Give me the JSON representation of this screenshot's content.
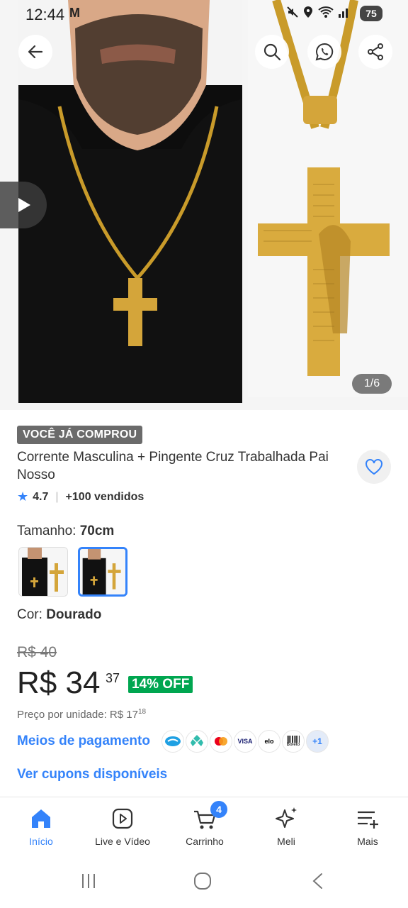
{
  "status_bar": {
    "time": "12:44",
    "mail_icon": "M",
    "battery": "75"
  },
  "gallery": {
    "counter": "1/6"
  },
  "product": {
    "badge": "VOCÊ JÁ COMPROU",
    "title": "Corrente Masculina + Pingente Cruz Trabalhada Pai Nosso",
    "rating": "4.7",
    "sold": "+100 vendidos",
    "size_label": "Tamanho: ",
    "size_value": "70cm",
    "color_label": "Cor: ",
    "color_value": "Dourado"
  },
  "pricing": {
    "old_price": "R$ 40",
    "price": "R$ 34",
    "price_cents": "37",
    "discount": "14% OFF",
    "unit_price_label": "Preço por unidade: R$ 17",
    "unit_price_cents": "18"
  },
  "payment": {
    "label": "Meios de pagamento",
    "methods": [
      "mercado-pago",
      "pix",
      "mastercard",
      "VISA",
      "elo",
      "Boleto"
    ],
    "more": "+1"
  },
  "coupons": {
    "label": "Ver cupons disponíveis"
  },
  "bottom_nav": {
    "items": [
      {
        "label": "Início",
        "icon": "home-icon",
        "active": true
      },
      {
        "label": "Live e Vídeo",
        "icon": "play-icon",
        "active": false
      },
      {
        "label": "Carrinho",
        "icon": "cart-icon",
        "active": false,
        "badge": "4"
      },
      {
        "label": "Meli",
        "icon": "sparkle-icon",
        "active": false
      },
      {
        "label": "Mais",
        "icon": "menu-plus-icon",
        "active": false
      }
    ]
  },
  "colors": {
    "accent": "#3483fa",
    "discount": "#00a650",
    "badge": "#6b6b6b"
  }
}
